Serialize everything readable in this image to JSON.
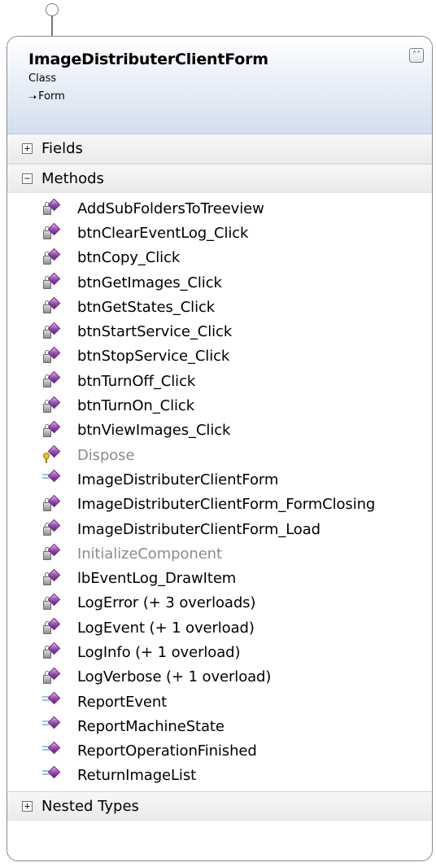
{
  "class": {
    "name": "ImageDistributerClientForm",
    "stereotype": "Class",
    "base_type": "Form",
    "collapse_glyph": "˄˄"
  },
  "sections": {
    "fields": {
      "label": "Fields",
      "expanded": false,
      "toggle": "+"
    },
    "methods": {
      "label": "Methods",
      "expanded": true,
      "toggle": "−"
    },
    "nested_types": {
      "label": "Nested Types",
      "expanded": false,
      "toggle": "+"
    }
  },
  "methods": [
    {
      "label": "AddSubFoldersToTreeview",
      "access": "private",
      "dim": false
    },
    {
      "label": "btnClearEventLog_Click",
      "access": "private",
      "dim": false
    },
    {
      "label": "btnCopy_Click",
      "access": "private",
      "dim": false
    },
    {
      "label": "btnGetImages_Click",
      "access": "private",
      "dim": false
    },
    {
      "label": "btnGetStates_Click",
      "access": "private",
      "dim": false
    },
    {
      "label": "btnStartService_Click",
      "access": "private",
      "dim": false
    },
    {
      "label": "btnStopService_Click",
      "access": "private",
      "dim": false
    },
    {
      "label": "btnTurnOff_Click",
      "access": "private",
      "dim": false
    },
    {
      "label": "btnTurnOn_Click",
      "access": "private",
      "dim": false
    },
    {
      "label": "btnViewImages_Click",
      "access": "private",
      "dim": false
    },
    {
      "label": "Dispose",
      "access": "protected",
      "dim": true
    },
    {
      "label": "ImageDistributerClientForm",
      "access": "public",
      "dim": false
    },
    {
      "label": "ImageDistributerClientForm_FormClosing",
      "access": "private",
      "dim": false
    },
    {
      "label": "ImageDistributerClientForm_Load",
      "access": "private",
      "dim": false
    },
    {
      "label": "InitializeComponent",
      "access": "private",
      "dim": true
    },
    {
      "label": "lbEventLog_DrawItem",
      "access": "private",
      "dim": false
    },
    {
      "label": "LogError (+ 3 overloads)",
      "access": "private",
      "dim": false
    },
    {
      "label": "LogEvent (+ 1 overload)",
      "access": "private",
      "dim": false
    },
    {
      "label": "LogInfo (+ 1 overload)",
      "access": "private",
      "dim": false
    },
    {
      "label": "LogVerbose (+ 1 overload)",
      "access": "private",
      "dim": false
    },
    {
      "label": "ReportEvent",
      "access": "public",
      "dim": false
    },
    {
      "label": "ReportMachineState",
      "access": "public",
      "dim": false
    },
    {
      "label": "ReportOperationFinished",
      "access": "public",
      "dim": false
    },
    {
      "label": "ReturnImageList",
      "access": "public",
      "dim": false
    }
  ],
  "colors": {
    "method_gem": "#a04cb8",
    "dim_text": "#8c8c8c",
    "header_gradient_end": "#d3dfee",
    "border": "#8a8a8a"
  },
  "icons": {
    "private": "lock-method-icon",
    "protected": "key-method-icon",
    "public": "public-method-icon"
  }
}
